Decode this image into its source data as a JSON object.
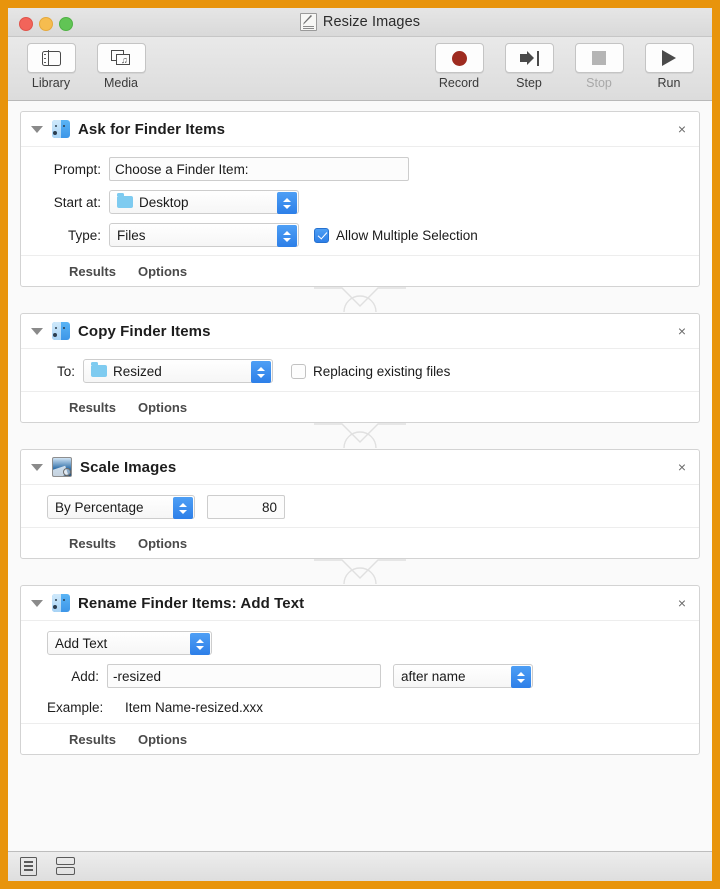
{
  "window": {
    "title": "Resize Images",
    "title_icon": "automator-document-icon",
    "traffic_lights": [
      "close",
      "minimize",
      "maximize"
    ]
  },
  "toolbar": {
    "left_items": [
      {
        "label": "Library",
        "icon": "library-panel-icon",
        "disabled": false
      },
      {
        "label": "Media",
        "icon": "media-browser-icon",
        "disabled": false
      }
    ],
    "right_items": [
      {
        "label": "Record",
        "icon": "record-circle-icon",
        "disabled": false
      },
      {
        "label": "Step",
        "icon": "step-arrow-icon",
        "disabled": false
      },
      {
        "label": "Stop",
        "icon": "stop-square-icon",
        "disabled": true
      },
      {
        "label": "Run",
        "icon": "run-triangle-icon",
        "disabled": false
      }
    ]
  },
  "footer_links": {
    "results": "Results",
    "options": "Options"
  },
  "close_glyph": "×",
  "actions": [
    {
      "id": "ask-for-finder-items",
      "title": "Ask for Finder Items",
      "icon": "finder-icon",
      "fields": {
        "prompt_label": "Prompt:",
        "prompt_value": "Choose a Finder Item:",
        "start_at_label": "Start at:",
        "start_at_value": "Desktop",
        "type_label": "Type:",
        "type_value": "Files",
        "allow_multiple_label": "Allow Multiple Selection",
        "allow_multiple_checked": true
      }
    },
    {
      "id": "copy-finder-items",
      "title": "Copy Finder Items",
      "icon": "finder-icon",
      "fields": {
        "to_label": "To:",
        "to_value": "Resized",
        "replacing_label": "Replacing existing files",
        "replacing_checked": false
      }
    },
    {
      "id": "scale-images",
      "title": "Scale Images",
      "icon": "scale-images-icon",
      "fields": {
        "mode_value": "By Percentage",
        "amount_value": "80"
      }
    },
    {
      "id": "rename-finder-items-add-text",
      "title": "Rename Finder Items: Add Text",
      "icon": "finder-icon",
      "fields": {
        "mode_value": "Add Text",
        "add_label": "Add:",
        "add_value": "-resized",
        "position_value": "after name",
        "example_label": "Example:",
        "example_value": "Item Name-resized.xxx"
      }
    }
  ],
  "statusbar": {
    "buttons": [
      {
        "icon": "log-view-icon",
        "name": "toggle-log"
      },
      {
        "icon": "split-view-icon",
        "name": "toggle-split-view"
      }
    ]
  },
  "colors": {
    "frame": "#e8940c",
    "accent_blue": "#2d7fe8",
    "record_red": "#9e2b20"
  }
}
